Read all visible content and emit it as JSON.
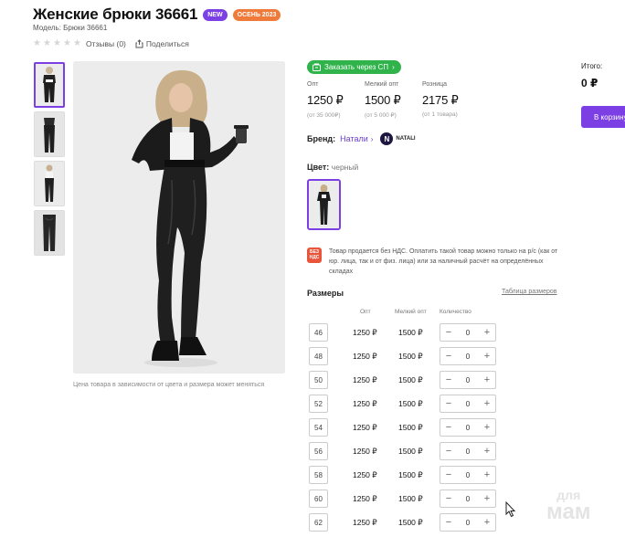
{
  "product": {
    "title": "Женские брюки 36661",
    "badge_new": "NEW",
    "badge_season": "ОСЕНЬ 2023",
    "model": "Модель: Брюки 36661",
    "reviews": "Отзывы (0)",
    "share": "Поделиться",
    "rating_stars": 0
  },
  "gallery": {
    "caption": "Цена товара в зависимости от цвета и размера может меняться"
  },
  "joint_purchase": {
    "label": "Заказать через СП"
  },
  "prices": [
    {
      "label": "Опт",
      "value": "1250 ₽",
      "note": "(от 35 000₽)"
    },
    {
      "label": "Мелкий опт",
      "value": "1500 ₽",
      "note": "(от 5 000 ₽)"
    },
    {
      "label": "Розница",
      "value": "2175 ₽",
      "note": "(от 1 товара)"
    }
  ],
  "brand": {
    "label": "Бренд:",
    "name": "Натали",
    "logo_letter": "N",
    "logo_text": "NATALI"
  },
  "color": {
    "label": "Цвет:",
    "value": "черный"
  },
  "vat": {
    "icon_line1": "БЕЗ",
    "icon_line2": "НДС",
    "text": "Товар продается без НДС. Оплатить такой товар можно только на р/с (как от юр. лица, так и от физ. лица) или за наличный расчёт на определённых складах"
  },
  "sizes": {
    "title": "Размеры",
    "table_link": "Таблица размеров",
    "col_opt": "Опт",
    "col_small_opt": "Мелкий опт",
    "col_qty": "Количество",
    "rows": [
      {
        "size": "46",
        "opt": "1250 ₽",
        "small_opt": "1500 ₽",
        "qty": "0"
      },
      {
        "size": "48",
        "opt": "1250 ₽",
        "small_opt": "1500 ₽",
        "qty": "0"
      },
      {
        "size": "50",
        "opt": "1250 ₽",
        "small_opt": "1500 ₽",
        "qty": "0"
      },
      {
        "size": "52",
        "opt": "1250 ₽",
        "small_opt": "1500 ₽",
        "qty": "0"
      },
      {
        "size": "54",
        "opt": "1250 ₽",
        "small_opt": "1500 ₽",
        "qty": "0"
      },
      {
        "size": "56",
        "opt": "1250 ₽",
        "small_opt": "1500 ₽",
        "qty": "0"
      },
      {
        "size": "58",
        "opt": "1250 ₽",
        "small_opt": "1500 ₽",
        "qty": "0"
      },
      {
        "size": "60",
        "opt": "1250 ₽",
        "small_opt": "1500 ₽",
        "qty": "0"
      },
      {
        "size": "62",
        "opt": "1250 ₽",
        "small_opt": "1500 ₽",
        "qty": "0"
      }
    ]
  },
  "summary": {
    "total_label": "Итого:",
    "total_value": "0 ₽",
    "cart_button": "В корзину"
  },
  "watermark": {
    "line1": "для",
    "line2": "мам"
  },
  "colors": {
    "accent": "#7b3fe4",
    "green": "#2fb34a",
    "badge_orange": "#f07a3a",
    "vat_red": "#e8553b"
  }
}
